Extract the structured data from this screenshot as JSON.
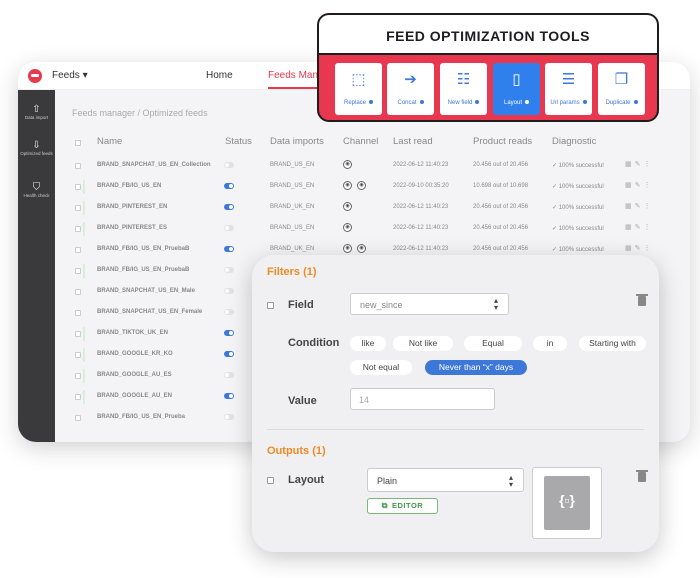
{
  "app": {
    "feeds_selector": "Feeds ▾",
    "nav_home": "Home",
    "nav_feeds_manager": "Feeds Manager",
    "accent_color": "#e8384f",
    "sidebar": [
      {
        "icon": "upload-icon",
        "label": "Data import"
      },
      {
        "icon": "download-icon",
        "label": "Optimized feeds"
      },
      {
        "icon": "shield-icon",
        "label": "Health check"
      }
    ],
    "breadcrumb": "Feeds manager / Optimized feeds",
    "columns": [
      "Name",
      "Status",
      "Data imports",
      "Channel",
      "Last read",
      "Product reads",
      "Diagnostic"
    ],
    "rows": [
      {
        "name": "BRAND_SNAPCHAT_US_EN_Collection",
        "on": false,
        "data_import": "BRAND_US_EN",
        "channels": 1,
        "last_read": "2022-06-12 11:40:23",
        "reads": "20.456 out of 20.456",
        "diagnostic": "✓ 100% successful",
        "mark": false
      },
      {
        "name": "BRAND_FB/IG_US_EN",
        "on": true,
        "data_import": "BRAND_US_EN",
        "channels": 2,
        "last_read": "2022-09-10 00:35:20",
        "reads": "10.698 out of 10.698",
        "diagnostic": "✓ 100% successful",
        "mark": true
      },
      {
        "name": "BRAND_PINTEREST_EN",
        "on": true,
        "data_import": "BRAND_UK_EN",
        "channels": 1,
        "last_read": "2022-06-12 11:40:23",
        "reads": "20.456 out of 20.456",
        "diagnostic": "✓ 100% successful",
        "mark": true
      },
      {
        "name": "BRAND_PINTEREST_ES",
        "on": false,
        "data_import": "BRAND_US_EN",
        "channels": 1,
        "last_read": "2022-06-12 11:40:23",
        "reads": "20.456 out of 20.456",
        "diagnostic": "✓ 100% successful",
        "mark": true
      },
      {
        "name": "BRAND_FB/IG_US_EN_PruebaB",
        "on": true,
        "data_import": "BRAND_UK_EN",
        "channels": 2,
        "last_read": "2022-06-12 11:40:23",
        "reads": "20.456 out of 20.456",
        "diagnostic": "✓ 100% successful",
        "mark": false
      },
      {
        "name": "BRAND_FB/IG_US_EN_PruebaB",
        "on": false,
        "data_import": "",
        "channels": 0,
        "last_read": "",
        "reads": "",
        "diagnostic": "",
        "mark": true
      },
      {
        "name": "BRAND_SNAPCHAT_US_EN_Male",
        "on": false,
        "data_import": "",
        "channels": 0,
        "last_read": "",
        "reads": "",
        "diagnostic": "",
        "mark": false
      },
      {
        "name": "BRAND_SNAPCHAT_US_EN_Female",
        "on": false,
        "data_import": "",
        "channels": 0,
        "last_read": "",
        "reads": "",
        "diagnostic": "",
        "mark": false
      },
      {
        "name": "BRAND_TIKTOK_UK_EN",
        "on": true,
        "data_import": "",
        "channels": 0,
        "last_read": "",
        "reads": "",
        "diagnostic": "",
        "mark": true
      },
      {
        "name": "BRAND_GOOGLE_KR_KO",
        "on": true,
        "data_import": "",
        "channels": 0,
        "last_read": "",
        "reads": "",
        "diagnostic": "",
        "mark": true
      },
      {
        "name": "BRAND_GOOGLE_AU_ES",
        "on": false,
        "data_import": "",
        "channels": 0,
        "last_read": "",
        "reads": "",
        "diagnostic": "",
        "mark": true
      },
      {
        "name": "BRAND_GOOGLE_AU_EN",
        "on": true,
        "data_import": "",
        "channels": 0,
        "last_read": "",
        "reads": "",
        "diagnostic": "",
        "mark": true
      },
      {
        "name": "BRAND_FB/IG_US_EN_Prueba",
        "on": false,
        "data_import": "",
        "channels": 0,
        "last_read": "",
        "reads": "",
        "diagnostic": "",
        "mark": false
      }
    ]
  },
  "tools": {
    "title": "FEED OPTIMIZATION  TOOLS",
    "items": [
      {
        "label": "Replace",
        "icon": "replace-icon",
        "active": false
      },
      {
        "label": "Concat",
        "icon": "concat-icon",
        "active": false
      },
      {
        "label": "New field",
        "icon": "new-field-icon",
        "active": false
      },
      {
        "label": "Layout",
        "icon": "layout-icon",
        "active": true
      },
      {
        "label": "Url params",
        "icon": "url-params-icon",
        "active": false
      },
      {
        "label": "Duplicate",
        "icon": "duplicate-icon",
        "active": false
      }
    ]
  },
  "filters": {
    "title": "Filters (1)",
    "field_label": "Field",
    "field_value": "new_since",
    "condition_label": "Condition",
    "conditions": [
      "like",
      "Not like",
      "Equal",
      "in",
      "Starting with",
      "Not equal",
      "Never than “x” days"
    ],
    "selected_condition": "Never than “x” days",
    "value_label": "Value",
    "value_placeholder": "14"
  },
  "outputs": {
    "title": "Outputs (1)",
    "layout_label": "Layout",
    "layout_value": "Plain",
    "editor_label": "EDITOR"
  }
}
